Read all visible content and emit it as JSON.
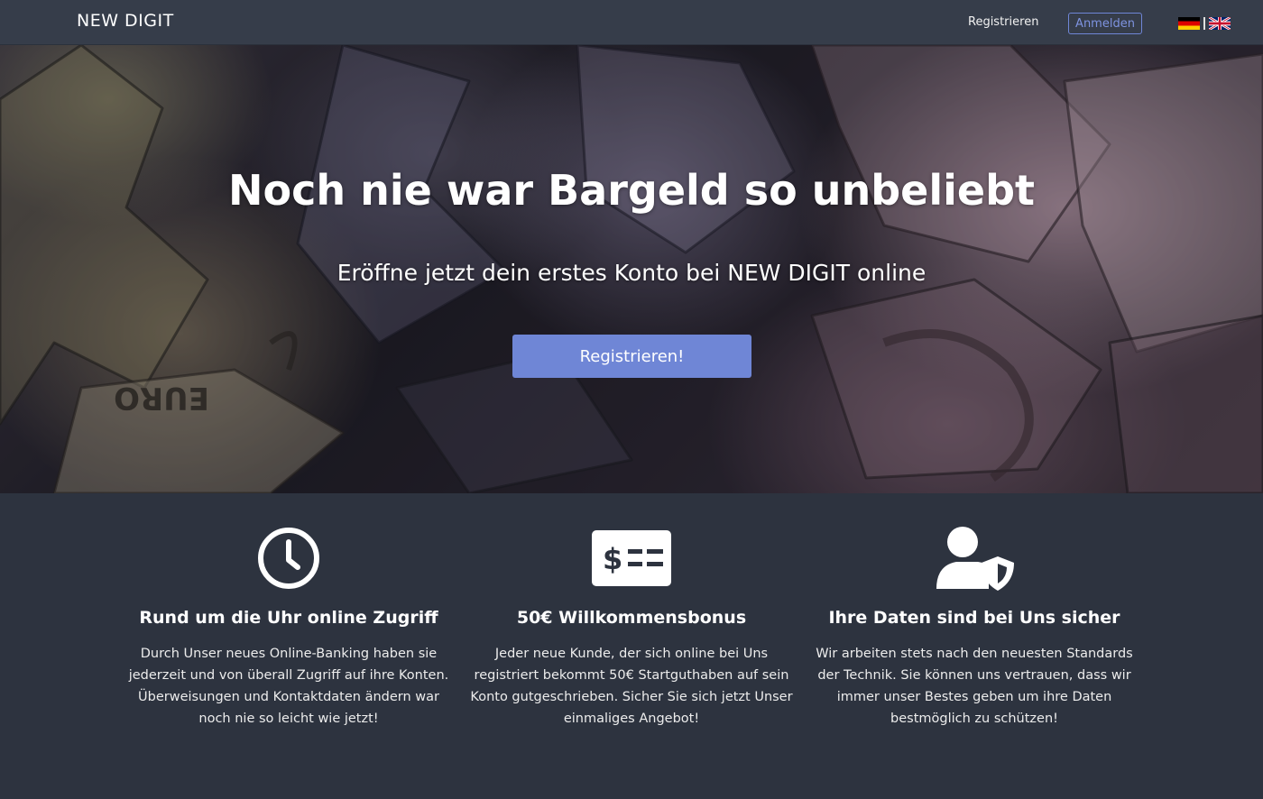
{
  "navbar": {
    "brand": "NEW DIGIT",
    "register_link": "Registrieren",
    "login_button": "Anmelden",
    "languages": [
      {
        "code": "de",
        "icon": "flag-de-icon"
      },
      {
        "code": "en",
        "icon": "flag-uk-icon"
      }
    ]
  },
  "hero": {
    "title": "Noch nie war Bargeld so unbeliebt",
    "subtitle": "Eröffne jetzt dein erstes Konto bei NEW DIGIT online",
    "cta_button": "Registrieren!",
    "accent_color": "#6f86d6",
    "banknote_text": "EURO"
  },
  "features": [
    {
      "icon": "clock-icon",
      "title": "Rund um die Uhr online Zugriff",
      "text": "Durch Unser neues Online-Banking haben sie jederzeit und von überall Zugriff auf ihre Konten. Überweisungen und Kontaktdaten ändern war noch nie so leicht wie jetzt!"
    },
    {
      "icon": "money-check-icon",
      "title": "50€ Willkommensbonus",
      "text": "Jeder neue Kunde, der sich online bei Uns registriert bekommt 50€ Startguthaben auf sein Konto gutgeschrieben. Sicher Sie sich jetzt Unser einmaliges Angebot!"
    },
    {
      "icon": "user-shield-icon",
      "title": "Ihre Daten sind bei Uns sicher",
      "text": "Wir arbeiten stets nach den neuesten Standards der Technik. Sie können uns vertrauen, dass wir immer unser Bestes geben um ihre Daten bestmöglich zu schützen!"
    }
  ],
  "colors": {
    "navbar_bg": "#363d4a",
    "page_bg": "#2d333f",
    "accent": "#6f86d6"
  }
}
